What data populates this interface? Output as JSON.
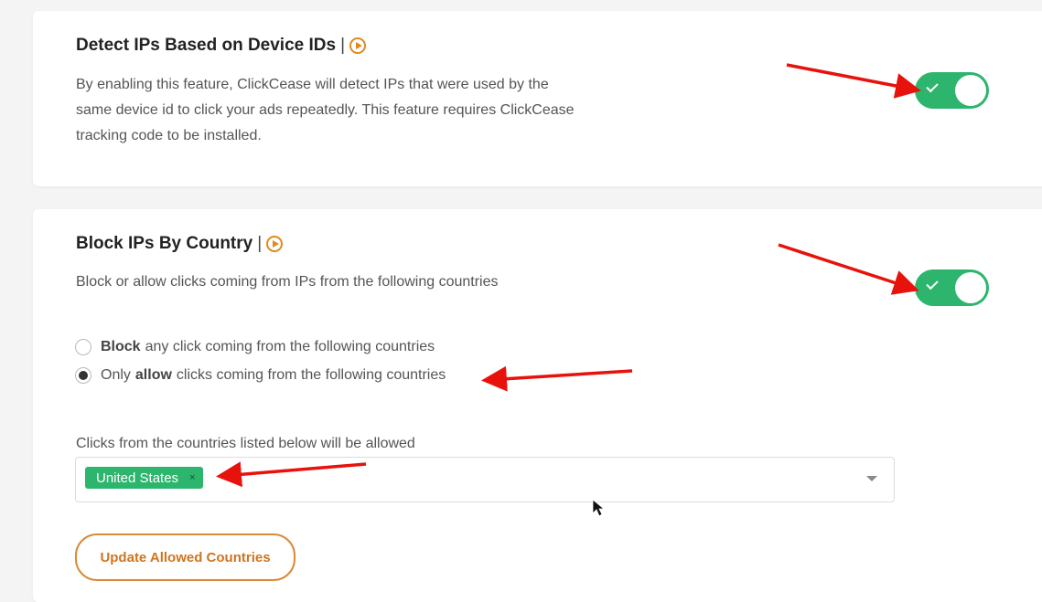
{
  "device_id_section": {
    "title": "Detect IPs Based on Device IDs",
    "separator": "|",
    "description": "By enabling this feature, ClickCease will detect IPs that were used by the same device id to click your ads repeatedly. This feature requires ClickCease tracking code to be installed.",
    "toggle_on": true
  },
  "country_section": {
    "title": "Block IPs By Country",
    "separator": "|",
    "description": "Block or allow clicks coming from IPs from the following countries",
    "toggle_on": true,
    "radio_block": {
      "bold": "Block",
      "rest": "any click coming from the following countries",
      "checked": false
    },
    "radio_allow": {
      "pre": "Only",
      "bold": "allow",
      "rest": "clicks coming from the following countries",
      "checked": true
    },
    "countries_label": "Clicks from the countries listed below will be allowed",
    "selected_countries": [
      "United States"
    ],
    "tag_remove_glyph": "×",
    "update_button": "Update Allowed Countries"
  },
  "colors": {
    "toggle_green": "#2db56e",
    "accent_orange": "#e08a1e",
    "annotation_red": "#e8120c"
  },
  "icons": [
    "play-circle-icon",
    "check-icon",
    "chevron-down-icon",
    "close-icon"
  ]
}
